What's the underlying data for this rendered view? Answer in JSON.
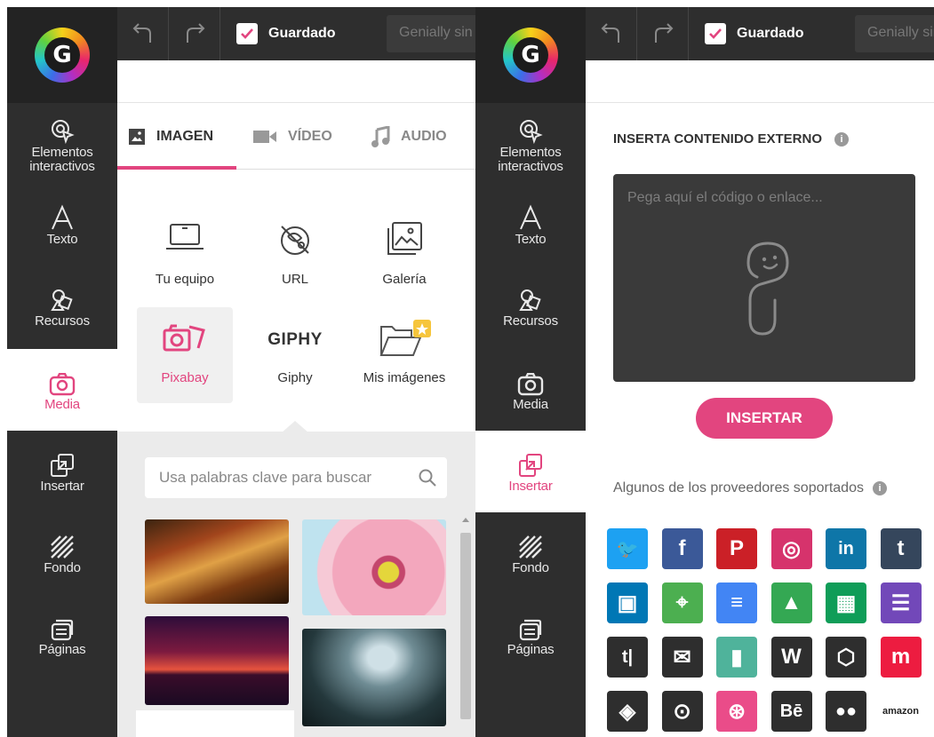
{
  "app": {
    "saved_label": "Guardado",
    "title_placeholder": "Genially sin título"
  },
  "sidebar": {
    "items": [
      {
        "label": "Elementos interactivos",
        "icon": "cursor-touch-icon"
      },
      {
        "label": "Texto",
        "icon": "text-icon"
      },
      {
        "label": "Recursos",
        "icon": "shapes-icon"
      },
      {
        "label": "Media",
        "icon": "camera-icon"
      },
      {
        "label": "Insertar",
        "icon": "insert-icon"
      },
      {
        "label": "Fondo",
        "icon": "background-icon"
      },
      {
        "label": "Páginas",
        "icon": "pages-icon"
      }
    ]
  },
  "media": {
    "tabs": [
      {
        "label": "IMAGEN",
        "icon": "image-icon",
        "active": true
      },
      {
        "label": "VÍDEO",
        "icon": "video-icon",
        "active": false
      },
      {
        "label": "AUDIO",
        "icon": "music-icon",
        "active": false
      }
    ],
    "sources": [
      {
        "label": "Tu equipo",
        "icon": "laptop-icon"
      },
      {
        "label": "URL",
        "icon": "link-globe-icon"
      },
      {
        "label": "Galería",
        "icon": "gallery-icon"
      },
      {
        "label": "Pixabay",
        "icon": "pixabay-camera-icon",
        "selected": true
      },
      {
        "label": "Giphy",
        "icon": "giphy-logo",
        "logo_text": "GIPHY"
      },
      {
        "label": "Mis imágenes",
        "icon": "folder-star-icon"
      }
    ],
    "search_placeholder": "Usa palabras clave para buscar"
  },
  "insert": {
    "heading": "INSERTA CONTENIDO EXTERNO",
    "code_placeholder": "Pega aquí el código o enlace...",
    "insert_button": "INSERTAR",
    "providers_label": "Algunos de los proveedores soportados",
    "providers": [
      {
        "name": "twitter",
        "glyph": "🐦",
        "color": "#1da1f2"
      },
      {
        "name": "facebook",
        "glyph": "f",
        "color": "#3b5998"
      },
      {
        "name": "pinterest",
        "glyph": "P",
        "color": "#cb2027"
      },
      {
        "name": "instagram",
        "glyph": "◎",
        "color": "#d6336c"
      },
      {
        "name": "linkedin",
        "glyph": "in",
        "color": "#0e76a8"
      },
      {
        "name": "tumblr",
        "glyph": "t",
        "color": "#35465c"
      },
      {
        "name": "slideshare",
        "glyph": "▣",
        "color": "#0077b5"
      },
      {
        "name": "google-maps",
        "glyph": "⌖",
        "color": "#4caf50"
      },
      {
        "name": "google-docs",
        "glyph": "≡",
        "color": "#4285f4"
      },
      {
        "name": "google-drive",
        "glyph": "▲",
        "color": "#34a853"
      },
      {
        "name": "google-sheets",
        "glyph": "▦",
        "color": "#0f9d58"
      },
      {
        "name": "google-forms",
        "glyph": "☰",
        "color": "#7248b9"
      },
      {
        "name": "tiny-letter",
        "glyph": "t|",
        "color": "#2e2e2e"
      },
      {
        "name": "mailchimp",
        "glyph": "✉",
        "color": "#2e2e2e"
      },
      {
        "name": "infogram",
        "glyph": "▮",
        "color": "#4fb39b"
      },
      {
        "name": "wikipedia",
        "glyph": "W",
        "color": "#2e2e2e"
      },
      {
        "name": "codesandbox",
        "glyph": "⬡",
        "color": "#2e2e2e"
      },
      {
        "name": "meetup",
        "glyph": "m",
        "color": "#ed1c40"
      },
      {
        "name": "codepen",
        "glyph": "◈",
        "color": "#2e2e2e"
      },
      {
        "name": "github",
        "glyph": "⊙",
        "color": "#2e2e2e"
      },
      {
        "name": "dribbble",
        "glyph": "⊛",
        "color": "#ea4c89"
      },
      {
        "name": "behance",
        "glyph": "Bē",
        "color": "#2e2e2e"
      },
      {
        "name": "flickr",
        "glyph": "●●",
        "color": "#2e2e2e"
      },
      {
        "name": "amazon",
        "glyph": "amazon",
        "color": "#ffffff"
      }
    ]
  },
  "colors": {
    "accent": "#e2457f",
    "sidebar": "#2e2e2e"
  }
}
